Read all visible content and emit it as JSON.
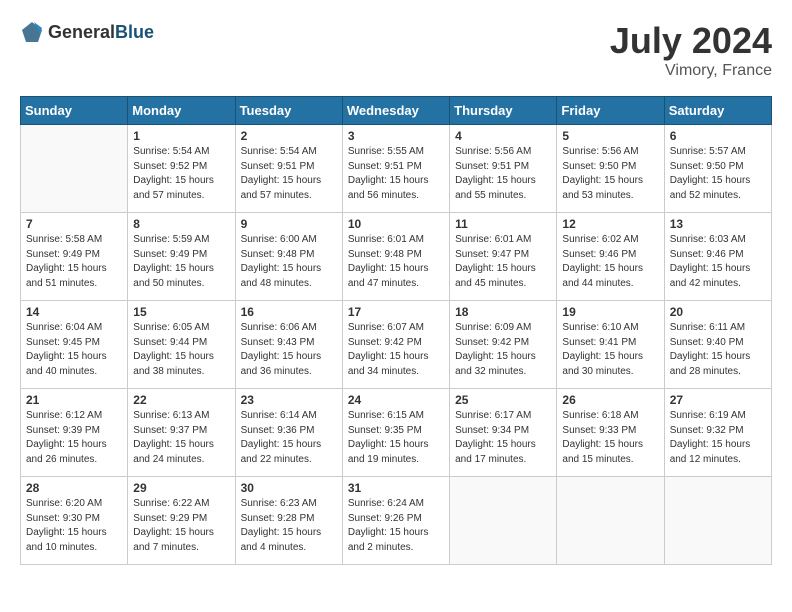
{
  "header": {
    "logo": {
      "general": "General",
      "blue": "Blue"
    },
    "title": "July 2024",
    "location": "Vimory, France"
  },
  "calendar": {
    "weekdays": [
      "Sunday",
      "Monday",
      "Tuesday",
      "Wednesday",
      "Thursday",
      "Friday",
      "Saturday"
    ],
    "weeks": [
      [
        {
          "day": "",
          "empty": true
        },
        {
          "day": "1",
          "sunrise": "5:54 AM",
          "sunset": "9:52 PM",
          "daylight": "15 hours and 57 minutes."
        },
        {
          "day": "2",
          "sunrise": "5:54 AM",
          "sunset": "9:51 PM",
          "daylight": "15 hours and 57 minutes."
        },
        {
          "day": "3",
          "sunrise": "5:55 AM",
          "sunset": "9:51 PM",
          "daylight": "15 hours and 56 minutes."
        },
        {
          "day": "4",
          "sunrise": "5:56 AM",
          "sunset": "9:51 PM",
          "daylight": "15 hours and 55 minutes."
        },
        {
          "day": "5",
          "sunrise": "5:56 AM",
          "sunset": "9:50 PM",
          "daylight": "15 hours and 53 minutes."
        },
        {
          "day": "6",
          "sunrise": "5:57 AM",
          "sunset": "9:50 PM",
          "daylight": "15 hours and 52 minutes."
        }
      ],
      [
        {
          "day": "7",
          "sunrise": "5:58 AM",
          "sunset": "9:49 PM",
          "daylight": "15 hours and 51 minutes."
        },
        {
          "day": "8",
          "sunrise": "5:59 AM",
          "sunset": "9:49 PM",
          "daylight": "15 hours and 50 minutes."
        },
        {
          "day": "9",
          "sunrise": "6:00 AM",
          "sunset": "9:48 PM",
          "daylight": "15 hours and 48 minutes."
        },
        {
          "day": "10",
          "sunrise": "6:01 AM",
          "sunset": "9:48 PM",
          "daylight": "15 hours and 47 minutes."
        },
        {
          "day": "11",
          "sunrise": "6:01 AM",
          "sunset": "9:47 PM",
          "daylight": "15 hours and 45 minutes."
        },
        {
          "day": "12",
          "sunrise": "6:02 AM",
          "sunset": "9:46 PM",
          "daylight": "15 hours and 44 minutes."
        },
        {
          "day": "13",
          "sunrise": "6:03 AM",
          "sunset": "9:46 PM",
          "daylight": "15 hours and 42 minutes."
        }
      ],
      [
        {
          "day": "14",
          "sunrise": "6:04 AM",
          "sunset": "9:45 PM",
          "daylight": "15 hours and 40 minutes."
        },
        {
          "day": "15",
          "sunrise": "6:05 AM",
          "sunset": "9:44 PM",
          "daylight": "15 hours and 38 minutes."
        },
        {
          "day": "16",
          "sunrise": "6:06 AM",
          "sunset": "9:43 PM",
          "daylight": "15 hours and 36 minutes."
        },
        {
          "day": "17",
          "sunrise": "6:07 AM",
          "sunset": "9:42 PM",
          "daylight": "15 hours and 34 minutes."
        },
        {
          "day": "18",
          "sunrise": "6:09 AM",
          "sunset": "9:42 PM",
          "daylight": "15 hours and 32 minutes."
        },
        {
          "day": "19",
          "sunrise": "6:10 AM",
          "sunset": "9:41 PM",
          "daylight": "15 hours and 30 minutes."
        },
        {
          "day": "20",
          "sunrise": "6:11 AM",
          "sunset": "9:40 PM",
          "daylight": "15 hours and 28 minutes."
        }
      ],
      [
        {
          "day": "21",
          "sunrise": "6:12 AM",
          "sunset": "9:39 PM",
          "daylight": "15 hours and 26 minutes."
        },
        {
          "day": "22",
          "sunrise": "6:13 AM",
          "sunset": "9:37 PM",
          "daylight": "15 hours and 24 minutes."
        },
        {
          "day": "23",
          "sunrise": "6:14 AM",
          "sunset": "9:36 PM",
          "daylight": "15 hours and 22 minutes."
        },
        {
          "day": "24",
          "sunrise": "6:15 AM",
          "sunset": "9:35 PM",
          "daylight": "15 hours and 19 minutes."
        },
        {
          "day": "25",
          "sunrise": "6:17 AM",
          "sunset": "9:34 PM",
          "daylight": "15 hours and 17 minutes."
        },
        {
          "day": "26",
          "sunrise": "6:18 AM",
          "sunset": "9:33 PM",
          "daylight": "15 hours and 15 minutes."
        },
        {
          "day": "27",
          "sunrise": "6:19 AM",
          "sunset": "9:32 PM",
          "daylight": "15 hours and 12 minutes."
        }
      ],
      [
        {
          "day": "28",
          "sunrise": "6:20 AM",
          "sunset": "9:30 PM",
          "daylight": "15 hours and 10 minutes."
        },
        {
          "day": "29",
          "sunrise": "6:22 AM",
          "sunset": "9:29 PM",
          "daylight": "15 hours and 7 minutes."
        },
        {
          "day": "30",
          "sunrise": "6:23 AM",
          "sunset": "9:28 PM",
          "daylight": "15 hours and 4 minutes."
        },
        {
          "day": "31",
          "sunrise": "6:24 AM",
          "sunset": "9:26 PM",
          "daylight": "15 hours and 2 minutes."
        },
        {
          "day": "",
          "empty": true
        },
        {
          "day": "",
          "empty": true
        },
        {
          "day": "",
          "empty": true
        }
      ]
    ]
  }
}
